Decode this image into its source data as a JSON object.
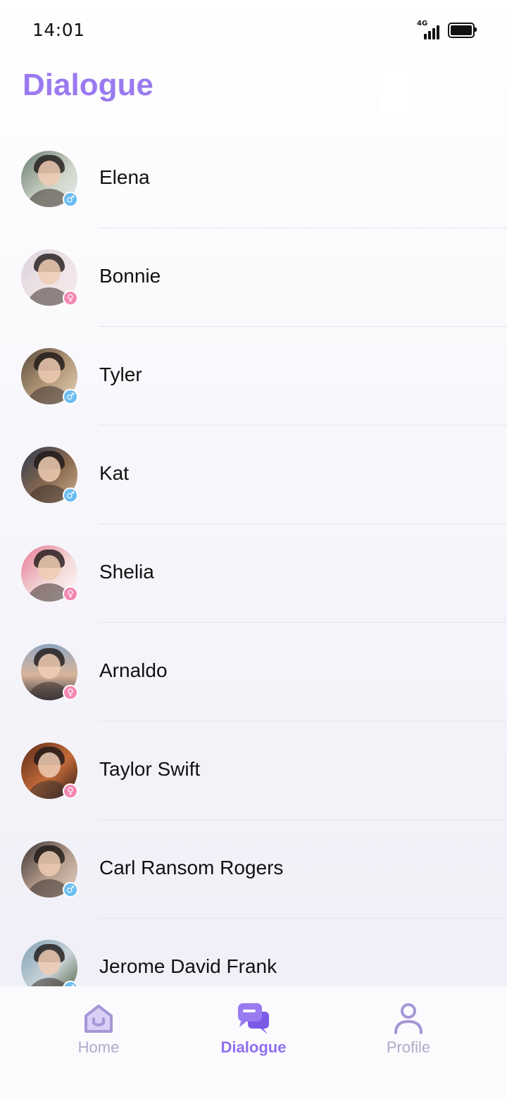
{
  "status_bar": {
    "time": "14:01",
    "network": "4G"
  },
  "header": {
    "title": "Dialogue"
  },
  "colors": {
    "accent": "#9a7af0",
    "male": "#6bbcf2",
    "female": "#f487b2",
    "tab_inactive": "#b0aacb"
  },
  "contacts": [
    {
      "name": "Elena",
      "gender": "male",
      "gender_icon": "male-symbol-icon",
      "avatar_bg": "linear-gradient(135deg,#6b7d72,#cfd6c8 60%,#e8ecef)"
    },
    {
      "name": "Bonnie",
      "gender": "female",
      "gender_icon": "female-symbol-icon",
      "avatar_bg": "linear-gradient(135deg,#d9d2dc,#efe3e6 55%,#f7ecef)"
    },
    {
      "name": "Tyler",
      "gender": "male",
      "gender_icon": "male-symbol-icon",
      "avatar_bg": "linear-gradient(135deg,#5a4a3a,#b59a7a 55%,#e6d5bf)"
    },
    {
      "name": "Kat",
      "gender": "male",
      "gender_icon": "male-symbol-icon",
      "avatar_bg": "linear-gradient(135deg,#2e3a52,#8a6a4f 55%,#d1b291)"
    },
    {
      "name": "Shelia",
      "gender": "female",
      "gender_icon": "female-symbol-icon",
      "avatar_bg": "linear-gradient(135deg,#e57b94,#f3d6d6 55%,#ffffff)"
    },
    {
      "name": "Arnaldo",
      "gender": "female",
      "gender_icon": "female-symbol-icon",
      "avatar_bg": "linear-gradient(180deg,#8fa6bf,#d8b49a 55%,#3a3a45)"
    },
    {
      "name": "Taylor Swift",
      "gender": "female",
      "gender_icon": "female-symbol-icon",
      "avatar_bg": "linear-gradient(135deg,#5a2a18,#c56b3a 55%,#2a1a14)"
    },
    {
      "name": "Carl Ransom Rogers",
      "gender": "male",
      "gender_icon": "male-symbol-icon",
      "avatar_bg": "linear-gradient(135deg,#3a3534,#b69c8c 55%,#e0d2c6)"
    },
    {
      "name": "Jerome David Frank",
      "gender": "male",
      "gender_icon": "male-symbol-icon",
      "avatar_bg": "linear-gradient(135deg,#7fa0b5,#c9d3d8 55%,#4a5a3a)"
    }
  ],
  "tabs": [
    {
      "label": "Home",
      "icon": "home-icon",
      "active": false
    },
    {
      "label": "Dialogue",
      "icon": "chat-bubbles-icon",
      "active": true
    },
    {
      "label": "Profile",
      "icon": "person-icon",
      "active": false
    }
  ]
}
